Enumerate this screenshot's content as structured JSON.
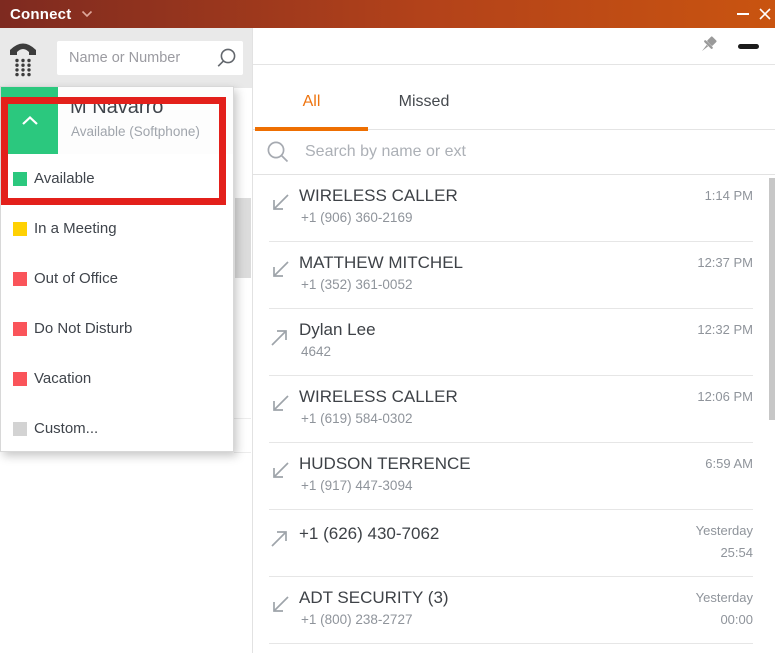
{
  "window": {
    "title": "Connect"
  },
  "annotation": {
    "color": "#E3201B"
  },
  "dialer": {
    "placeholder": "Name or Number"
  },
  "status_panel": {
    "user_name": "M Navarro",
    "user_status": "Available (Softphone)",
    "options": [
      {
        "label": "Available",
        "color": "#2BC87E"
      },
      {
        "label": "In a Meeting",
        "color": "#FFD103"
      },
      {
        "label": "Out of Office",
        "color": "#FA545A"
      },
      {
        "label": "Do Not Disturb",
        "color": "#FA545A"
      },
      {
        "label": "Vacation",
        "color": "#FA545A"
      },
      {
        "label": "Custom...",
        "color": "#D3D3D3"
      }
    ]
  },
  "recents": {
    "tabs": [
      {
        "label": "All",
        "active": true
      },
      {
        "label": "Missed",
        "active": false
      }
    ],
    "search_placeholder": "Search by name or ext",
    "calls": [
      {
        "direction": "incoming",
        "name": "WIRELESS CALLER",
        "number": "+1 (906) 360-2169",
        "time": "1:14 PM"
      },
      {
        "direction": "incoming",
        "name": "MATTHEW MITCHEL",
        "number": "+1 (352) 361-0052",
        "time": "12:37 PM"
      },
      {
        "direction": "outgoing",
        "name": "Dylan Lee",
        "number": "4642",
        "time": "12:32 PM"
      },
      {
        "direction": "incoming",
        "name": "WIRELESS CALLER",
        "number": "+1 (619) 584-0302",
        "time": "12:06 PM"
      },
      {
        "direction": "incoming",
        "name": "HUDSON TERRENCE",
        "number": "+1 (917) 447-3094",
        "time": "6:59 AM"
      },
      {
        "direction": "outgoing",
        "name": "+1 (626) 430-7062",
        "time": "Yesterday",
        "time2": "25:54"
      },
      {
        "direction": "incoming",
        "name": "ADT SECURITY (3)",
        "number": "+1 (800) 238-2727",
        "time": "Yesterday",
        "time2": "00:00"
      }
    ]
  },
  "colors": {
    "accent_orange": "#EE7410",
    "titlebar_left": "#7E2A20",
    "titlebar_right": "#C95410",
    "status_green": "#2BC87E"
  }
}
